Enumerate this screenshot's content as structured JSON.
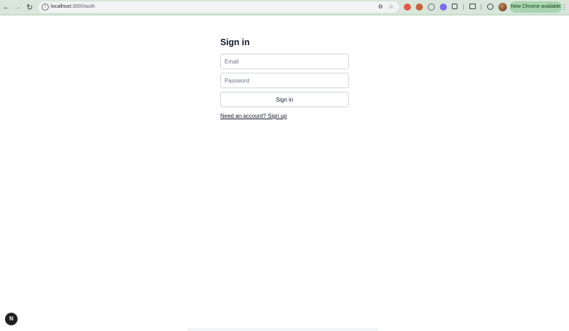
{
  "browser": {
    "url_host": "localhost",
    "url_path": ":3000/auth",
    "update_label": "New Chrome available",
    "icons": {
      "back": "arrow-left-icon",
      "forward": "arrow-right-icon",
      "reload": "reload-icon",
      "site_info": "site-info-icon",
      "translate": "translate-icon",
      "bookmark": "star-icon",
      "extensions": "puzzle-icon",
      "menu": "more-vert-icon"
    }
  },
  "auth": {
    "title": "Sign in",
    "email_placeholder": "Email",
    "password_placeholder": "Password",
    "submit_label": "Sign in",
    "switch_link": "Need an account? Sign up"
  },
  "dev_badge": {
    "label": "N",
    "icon": "nextjs-logo-icon"
  },
  "colors": {
    "chrome_bar": "#d9e6dc",
    "update_pill": "#a8d5b0",
    "text": "#111827",
    "border": "#d1d5db"
  }
}
